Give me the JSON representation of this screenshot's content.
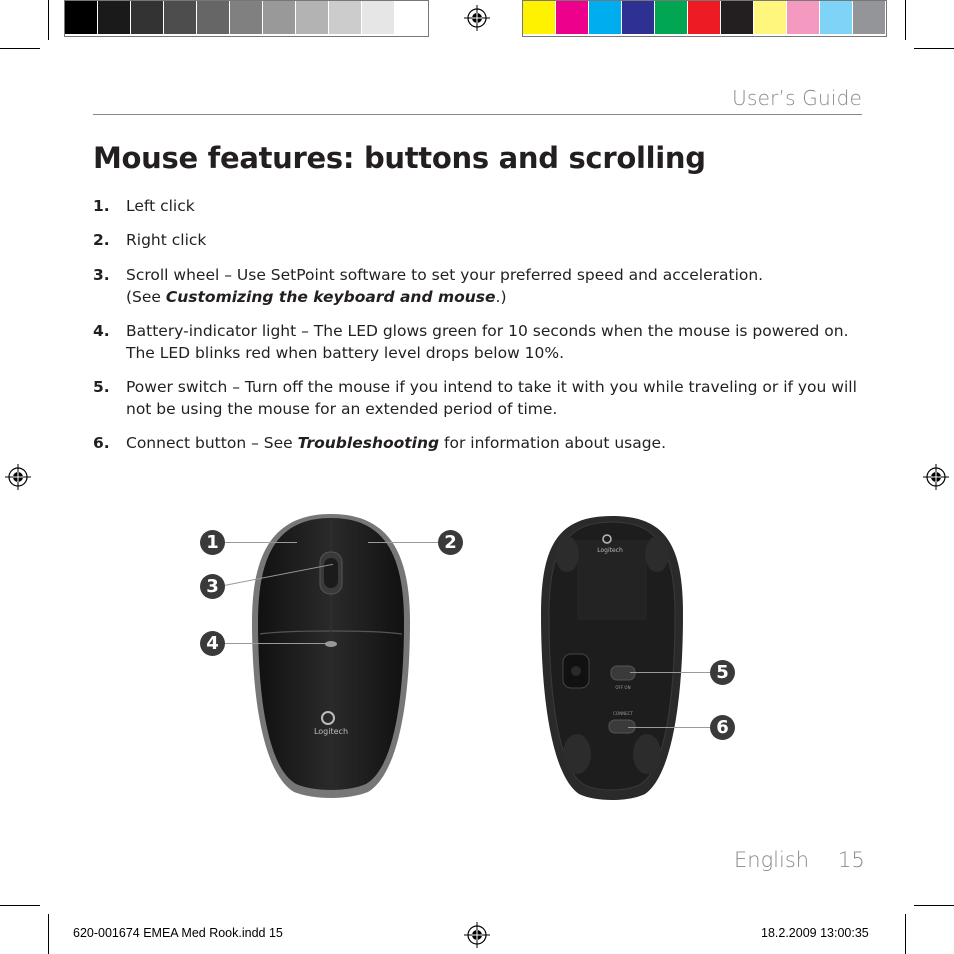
{
  "print_marks": {
    "grayscale_bar": [
      "#000000",
      "#1a1a1a",
      "#333333",
      "#4d4d4d",
      "#666666",
      "#808080",
      "#999999",
      "#b3b3b3",
      "#cccccc",
      "#e6e6e6",
      "#ffffff"
    ],
    "color_bar": [
      "#fff200",
      "#ec008c",
      "#00aeef",
      "#2e3192",
      "#00a651",
      "#ed1c24",
      "#231f20",
      "#fff77d",
      "#f49ac1",
      "#7fd3f7",
      "#939598"
    ]
  },
  "header": {
    "running_head": "User’s Guide"
  },
  "page": {
    "title": "Mouse features: buttons and scrolling",
    "items": [
      {
        "num": "1.",
        "text": "Left click"
      },
      {
        "num": "2.",
        "text": "Right click"
      },
      {
        "num": "3.",
        "text": "Scroll wheel – Use SetPoint software to set your preferred speed and acceleration.",
        "line2_prefix": "(See ",
        "line2_emphasis": "Customizing the keyboard and mouse",
        "line2_suffix": ".)"
      },
      {
        "num": "4.",
        "text": "Battery-indicator light – The LED glows green for 10 seconds when the mouse is powered on.",
        "line2": "The LED blinks red when battery level drops below 10%."
      },
      {
        "num": "5.",
        "text": "Power switch – Turn off the mouse if you intend to take it with you while traveling or if you will",
        "line2": "not be using the mouse for an extended period of time."
      },
      {
        "num": "6.",
        "prefix": "Connect button – See ",
        "emphasis": "Troubleshooting",
        "suffix": " for information about usage."
      }
    ]
  },
  "figure": {
    "callouts": [
      "1",
      "2",
      "3",
      "4",
      "5",
      "6"
    ],
    "top_view_logo": "Logitech",
    "bottom_view_logo": "Logitech",
    "bottom_labels": {
      "switch": "OFF  ON",
      "connect": "CONNECT"
    }
  },
  "footer": {
    "language": "English",
    "page_number": "15"
  },
  "slug": {
    "file": "620-001674 EMEA Med Rook.indd   15",
    "datetime": "18.2.2009   13:00:35"
  }
}
